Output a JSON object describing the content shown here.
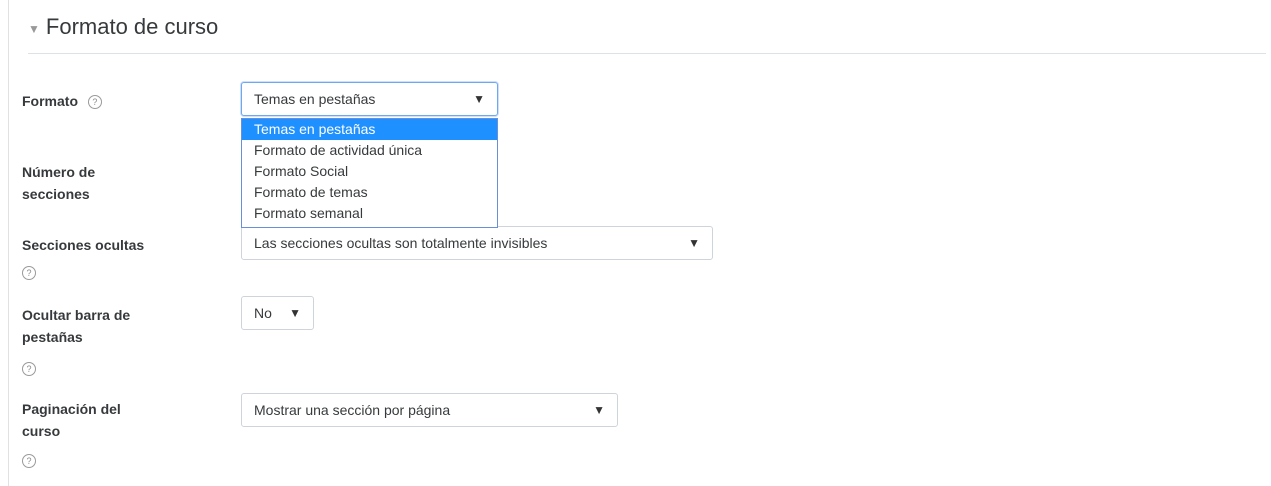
{
  "section": {
    "title": "Formato de curso",
    "collapse_icon": "triangle-down-icon"
  },
  "fields": {
    "formato": {
      "label": "Formato",
      "value": "Temas en pestañas",
      "options": [
        "Temas en pestañas",
        "Formato de actividad única",
        "Formato Social",
        "Formato de temas",
        "Formato semanal"
      ],
      "highlighted_option": "Temas en pestañas"
    },
    "numero_secciones": {
      "label_line1": "Número de",
      "label_line2": "secciones"
    },
    "secciones_ocultas": {
      "label": "Secciones ocultas",
      "value": "Las secciones ocultas son totalmente invisibles"
    },
    "ocultar_barra": {
      "label_line1": "Ocultar barra de",
      "label_line2": "pestañas",
      "value": "No"
    },
    "paginacion": {
      "label_line1": "Paginación del",
      "label_line2": "curso",
      "value": "Mostrar una sección por página"
    }
  },
  "icons": {
    "help": "?",
    "caret": "▼",
    "collapse": "▼"
  },
  "colors": {
    "highlight": "#1e90ff",
    "border": "#ced4da",
    "focus": "#6ea8f2"
  }
}
